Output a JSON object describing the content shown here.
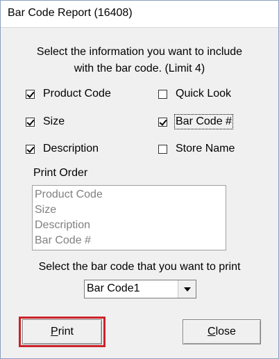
{
  "window": {
    "title": "Bar Code Report (16408)"
  },
  "instructions": {
    "line1": "Select the information you want to include",
    "line2": "with the bar code. (Limit 4)"
  },
  "options": {
    "product_code": {
      "label": "Product Code",
      "checked": true
    },
    "size": {
      "label": "Size",
      "checked": true
    },
    "description": {
      "label": "Description",
      "checked": true
    },
    "quick_look": {
      "label": "Quick Look",
      "checked": false
    },
    "bar_code_num": {
      "label": "Bar Code #",
      "checked": true
    },
    "store_name": {
      "label": "Store Name",
      "checked": false
    }
  },
  "print_order": {
    "label": "Print Order",
    "items": [
      "Product Code",
      "Size",
      "Description",
      "Bar Code #"
    ]
  },
  "barcode_select": {
    "label": "Select the bar code that you want to print",
    "value": "Bar Code1"
  },
  "buttons": {
    "print": {
      "mnemonic": "P",
      "rest": "rint"
    },
    "close": {
      "mnemonic": "C",
      "rest": "lose"
    }
  },
  "colors": {
    "highlight": "#cc2229",
    "list_text": "#808080",
    "dialog_bg": "#f0f0f0"
  }
}
